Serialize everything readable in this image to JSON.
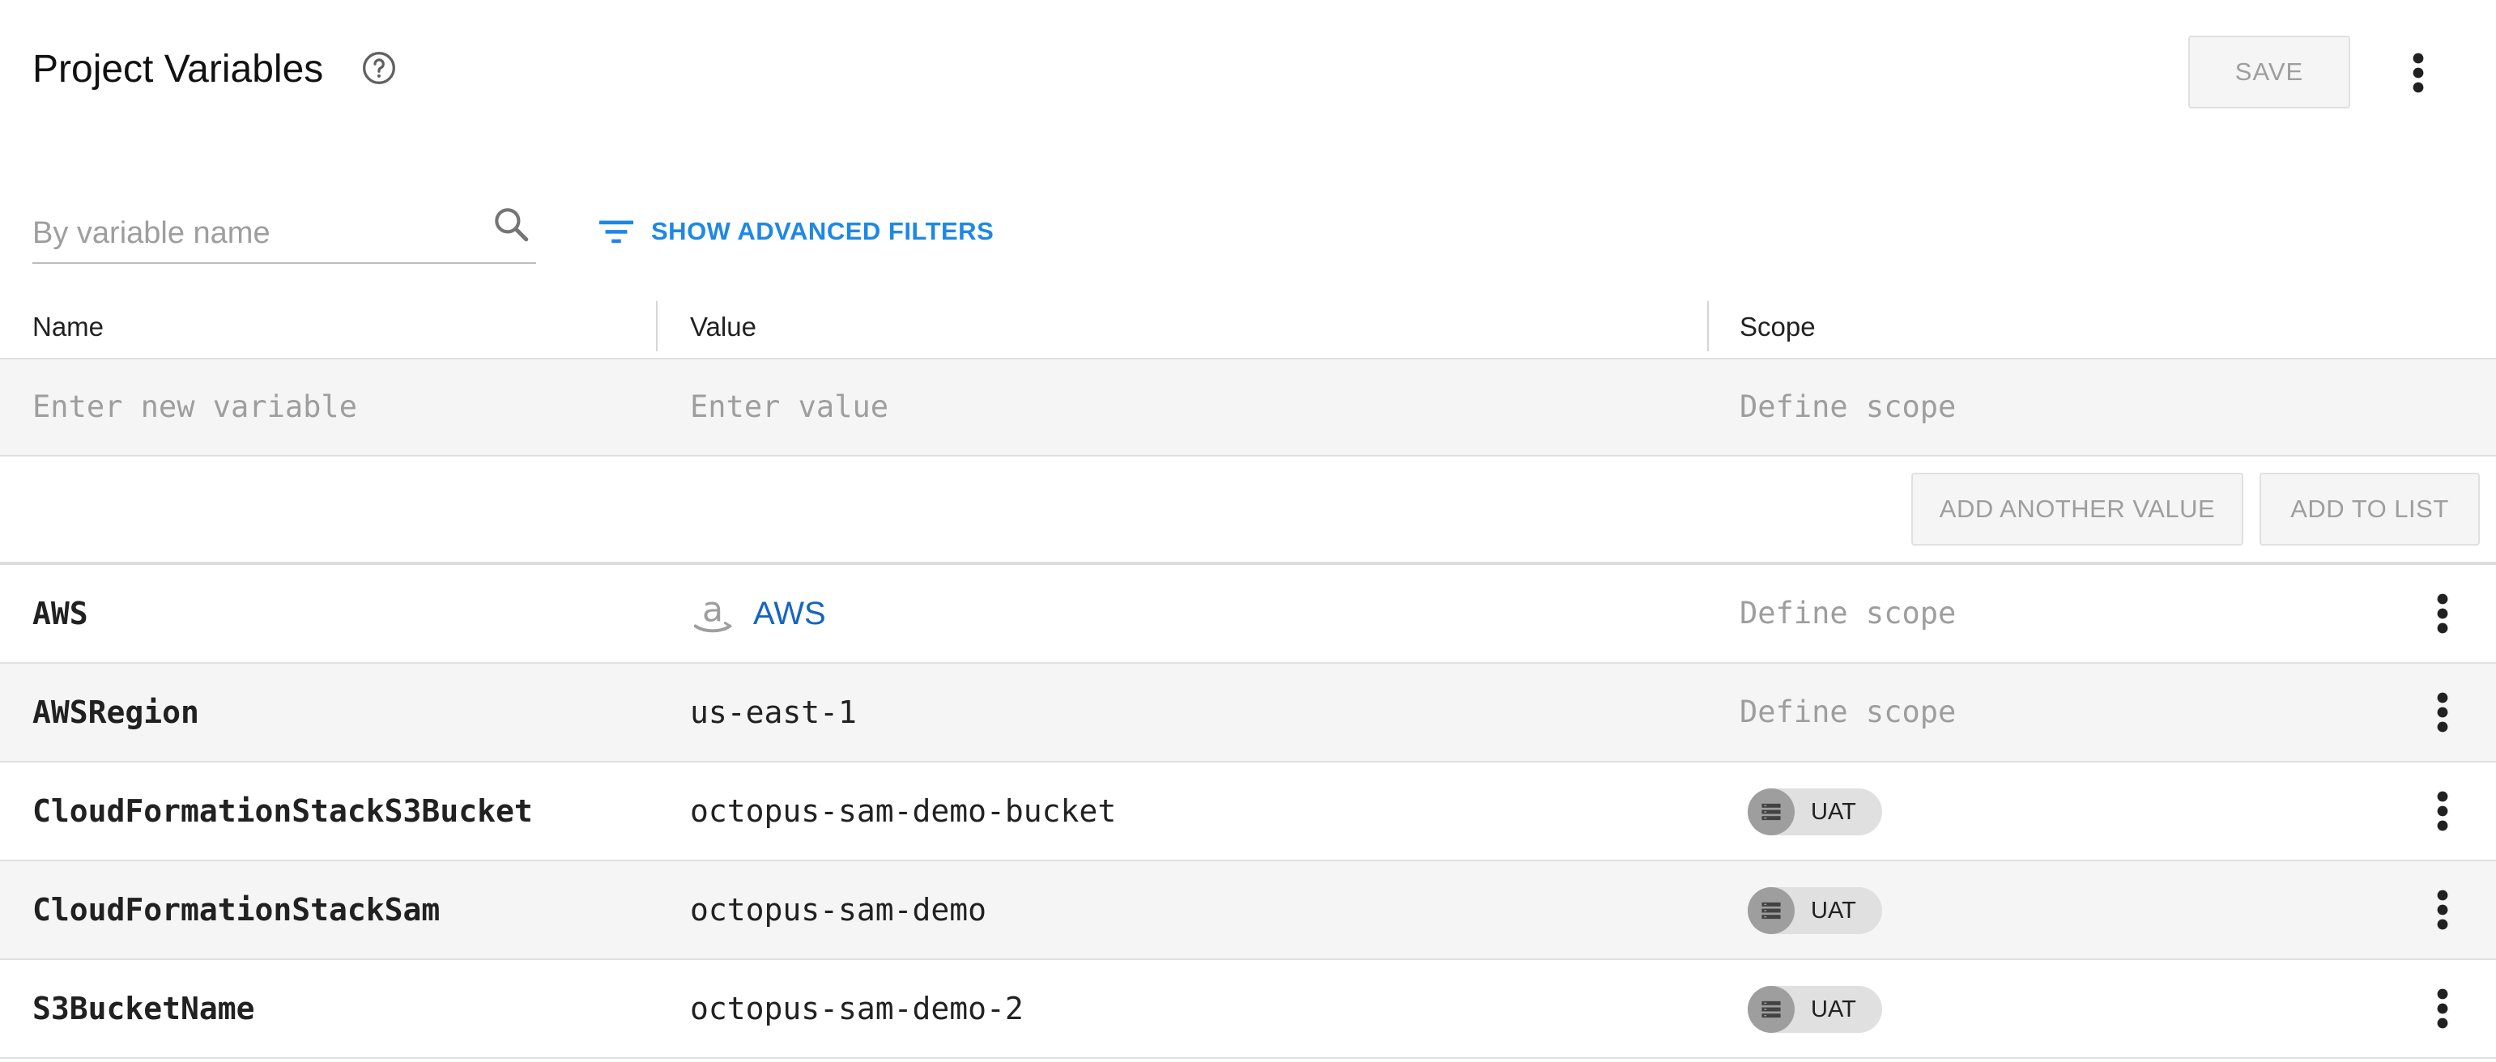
{
  "header": {
    "title": "Project Variables",
    "save_label": "SAVE"
  },
  "filter": {
    "placeholder": "By variable name",
    "advanced_label": "SHOW ADVANCED FILTERS"
  },
  "table": {
    "columns": [
      "Name",
      "Value",
      "Scope"
    ],
    "new_row": {
      "name_placeholder": "Enter new variable",
      "value_placeholder": "Enter value",
      "scope_placeholder": "Define scope"
    },
    "buttons": {
      "add_another_value": "ADD ANOTHER VALUE",
      "add_to_list": "ADD TO LIST"
    },
    "rows": [
      {
        "name": "AWS",
        "value": "AWS",
        "value_icon": "amazon-icon",
        "scope": "Define scope"
      },
      {
        "name": "AWSRegion",
        "value": "us-east-1",
        "scope": "Define scope"
      },
      {
        "name": "CloudFormationStackS3Bucket",
        "value": "octopus-sam-demo-bucket",
        "scope_chip": "UAT"
      },
      {
        "name": "CloudFormationStackSam",
        "value": "octopus-sam-demo",
        "scope_chip": "UAT"
      },
      {
        "name": "S3BucketName",
        "value": "octopus-sam-demo-2",
        "scope_chip": "UAT"
      }
    ]
  },
  "colors": {
    "accent": "#1e88e5",
    "link": "#1565c0",
    "muted": "#9e9e9e",
    "row_alt": "#f5f5f5"
  }
}
